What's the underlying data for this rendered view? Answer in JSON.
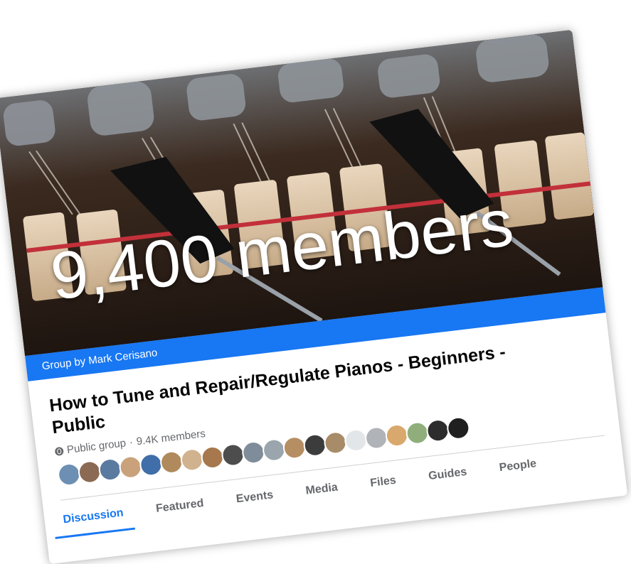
{
  "cover": {
    "overlay_text": "9,400 members"
  },
  "group": {
    "byline": "Group by Mark Cerisano",
    "title": "How to Tune and Repair/Regulate Pianos - Beginners - Public",
    "privacy": "Public group",
    "separator": "·",
    "member_count": "9.4K members"
  },
  "avatars": [
    {
      "color": "#6d8fb3"
    },
    {
      "color": "#8a6a52"
    },
    {
      "color": "#5b7aa0"
    },
    {
      "color": "#c9a27c"
    },
    {
      "color": "#3f6ea8"
    },
    {
      "color": "#b08a5c"
    },
    {
      "color": "#d0b28f"
    },
    {
      "color": "#a7784d"
    },
    {
      "color": "#4d4d4d"
    },
    {
      "color": "#7f8c99"
    },
    {
      "color": "#9aa5ad"
    },
    {
      "color": "#b58e63"
    },
    {
      "color": "#3c3c3c"
    },
    {
      "color": "#a88b68"
    },
    {
      "color": "#e3e6e9"
    },
    {
      "color": "#b0b3b8"
    },
    {
      "color": "#d9a86c"
    },
    {
      "color": "#8fae7c"
    },
    {
      "color": "#2d2d2d"
    },
    {
      "color": "#1f1f1f"
    }
  ],
  "tabs": [
    {
      "label": "Discussion",
      "active": true
    },
    {
      "label": "Featured"
    },
    {
      "label": "Events"
    },
    {
      "label": "Media"
    },
    {
      "label": "Files"
    },
    {
      "label": "Guides"
    },
    {
      "label": "People"
    }
  ],
  "colors": {
    "accent": "#1877f2",
    "muted": "#65676b"
  }
}
